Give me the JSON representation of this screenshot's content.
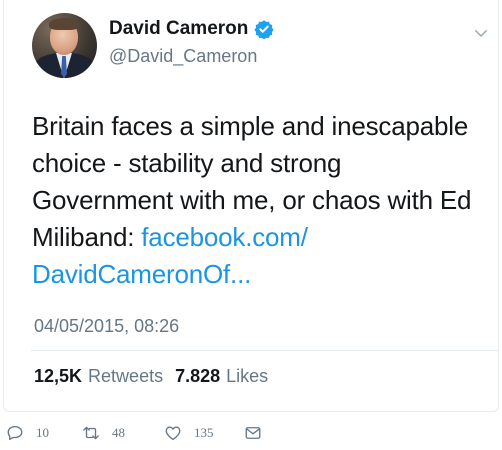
{
  "author": {
    "display_name": "David Cameron",
    "handle": "@David_Cameron",
    "verified": true,
    "avatar_icon": "profile-photo"
  },
  "tweet": {
    "text": "Britain faces a simple and inescapable choice - stability and strong Government with me, or chaos with Ed Miliband: ",
    "link_line1": "facebook.com/",
    "link_line2": "DavidCameronOf...",
    "link_color": "#1b95e0",
    "timestamp": "04/05/2015, 08:26"
  },
  "stats": {
    "retweets_count": "12,5K",
    "retweets_label": "Retweets",
    "likes_count": "7.828",
    "likes_label": "Likes"
  },
  "actions": {
    "reply_count": "10",
    "retweet_count": "48",
    "like_count": "135",
    "icons": [
      "reply-icon",
      "retweet-icon",
      "like-icon",
      "direct-message-icon"
    ]
  },
  "colors": {
    "verified_badge": "#1da1f2",
    "secondary_text": "#657786",
    "primary_text": "#14171a"
  }
}
